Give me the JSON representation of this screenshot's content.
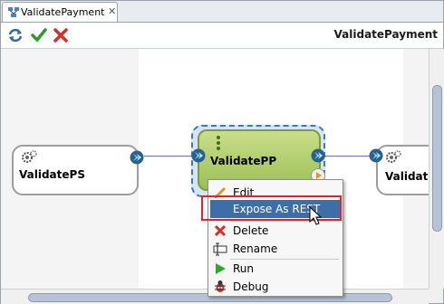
{
  "tab": {
    "label": "ValidatePayment",
    "close_glyph": "✕"
  },
  "toolbar": {
    "title": "ValidatePayment",
    "icons": [
      "refresh-icon",
      "check-icon",
      "cancel-icon"
    ]
  },
  "components": {
    "left": {
      "label": "ValidatePS"
    },
    "center": {
      "label": "ValidatePP"
    },
    "right": {
      "label": "ValidateI"
    }
  },
  "context_menu": {
    "items": [
      {
        "label": "Edit",
        "icon": "pencil-icon"
      },
      {
        "label": "Expose As REST",
        "icon": "",
        "highlighted": true
      },
      {
        "label": "Delete",
        "icon": "red-x-icon"
      },
      {
        "label": "Rename",
        "icon": "rename-icon"
      },
      {
        "label": "Run",
        "icon": "run-triangle-icon"
      },
      {
        "label": "Debug",
        "icon": "bug-icon"
      }
    ]
  },
  "colors": {
    "highlight": "#3e6ea8",
    "callout": "#e0242c",
    "component_green": "#9cc056",
    "selection": "#3a78c2"
  }
}
